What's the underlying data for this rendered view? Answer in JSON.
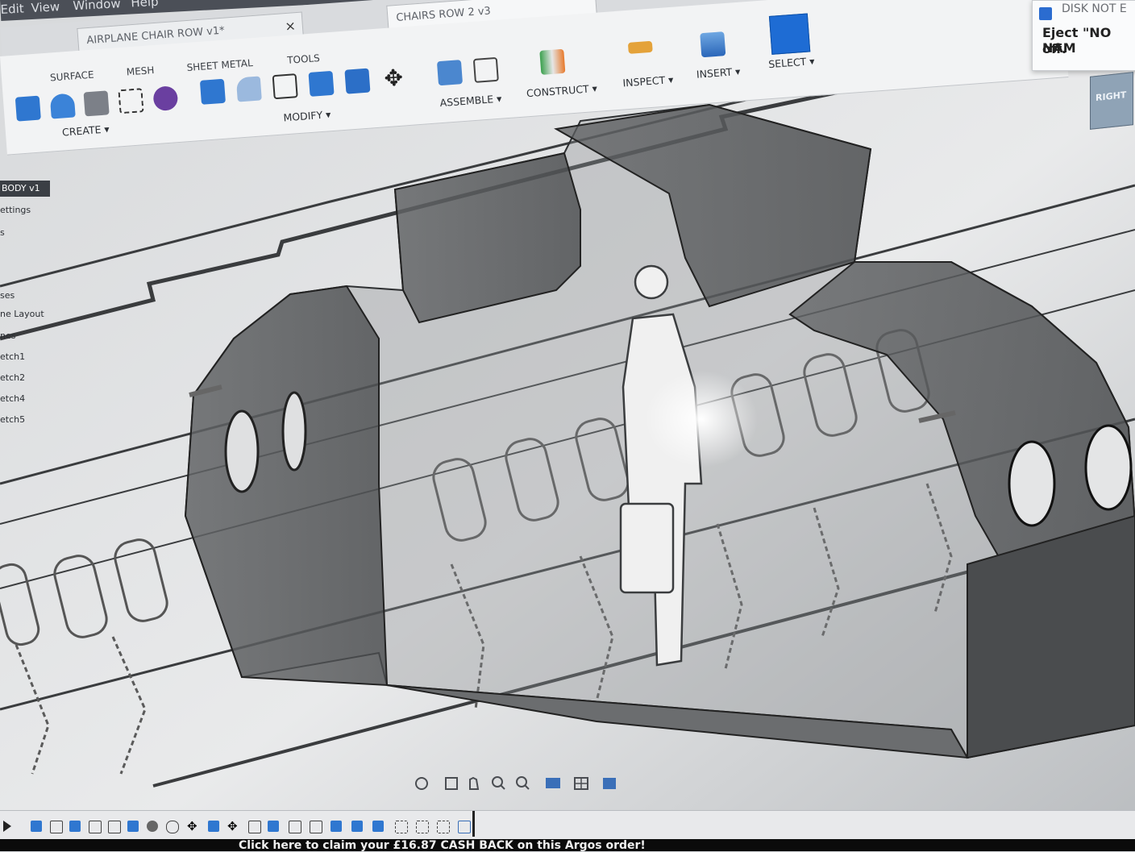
{
  "menubar": {
    "items": [
      "Edit",
      "View",
      "Window",
      "Help"
    ]
  },
  "tabs": [
    {
      "label": "AIRPLANE CHAIR ROW v1*",
      "close": "×"
    },
    {
      "label": "CHAIRS ROW 2 v3"
    }
  ],
  "toolbar": {
    "tabs": [
      "SURFACE",
      "MESH",
      "SHEET METAL",
      "TOOLS"
    ],
    "groups": {
      "create": "CREATE ▾",
      "modify": "MODIFY ▾",
      "assemble": "ASSEMBLE ▾",
      "construct": "CONSTRUCT ▾",
      "inspect": "INSPECT ▾",
      "insert": "INSERT ▾",
      "select": "SELECT ▾"
    }
  },
  "browser": {
    "root": "BODY v1",
    "items": [
      "ettings",
      "s",
      "ses",
      "ne Layout",
      "nes",
      "etch1",
      "etch2",
      "etch4",
      "etch5"
    ]
  },
  "notification": {
    "title": "DISK NOT E",
    "line1": "Eject \"NO NAM",
    "line2": "off."
  },
  "viewcube": {
    "face": "RIGHT"
  },
  "promo": {
    "text": "Click here to claim your £16.87 CASH BACK on this Argos order!"
  },
  "icons": {
    "nav": [
      "orbit-icon",
      "look-at-icon",
      "pan-icon",
      "zoom-icon",
      "fit-icon",
      "display-settings-icon",
      "grid-icon",
      "viewports-icon"
    ]
  }
}
